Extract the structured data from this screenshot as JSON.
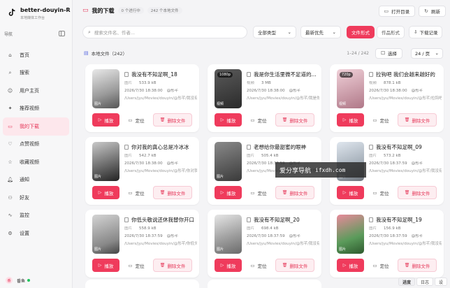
{
  "app": {
    "title": "better-douyin-R",
    "subtitle": "本地媒体工作台"
  },
  "sidebar": {
    "nav_heading": "导航",
    "items": [
      {
        "label": "首页",
        "icon": "home-icon"
      },
      {
        "label": "搜索",
        "icon": "search-icon"
      },
      {
        "label": "用户主页",
        "icon": "user-icon"
      },
      {
        "label": "推荐视频",
        "icon": "sparkle-icon"
      },
      {
        "label": "我的下载",
        "icon": "folder-icon",
        "active": true
      },
      {
        "label": "点赞视频",
        "icon": "heart-icon"
      },
      {
        "label": "收藏视频",
        "icon": "star-icon"
      },
      {
        "label": "通知",
        "icon": "bell-icon"
      },
      {
        "label": "好友",
        "icon": "friends-icon"
      },
      {
        "label": "监控",
        "icon": "pulse-icon"
      },
      {
        "label": "设置",
        "icon": "gear-icon"
      }
    ],
    "user": {
      "name": "番鱼",
      "avatar_text": "番"
    }
  },
  "header": {
    "title": "我的下载",
    "running_tasks": "0 个进行中",
    "local_files": "242 个本地文件",
    "open_folder": "打开目录",
    "refresh": "刷新"
  },
  "toolbar": {
    "search_placeholder": "搜索文件名、作者...",
    "type_filter": "全部类型",
    "sort": "最新优先",
    "view_files": "文件形式",
    "view_works": "作品形式",
    "download_records": "下载记录"
  },
  "list": {
    "label": "本地文件（242）",
    "range": "1–24 / 242",
    "select": "选择",
    "per_page": "24 / 页"
  },
  "card_labels": {
    "play": "播放",
    "locate": "定位",
    "delete": "删除文件",
    "image_tag": "图片",
    "video_tag": "视频"
  },
  "cards": [
    {
      "title": "我没有不知足啊_18",
      "kind": "图片",
      "size": "533.9 kB",
      "date": "2026/7/30 18:38:00",
      "author": "@彤芊",
      "path": "/Users/jyu/Movies/douyin/@彤芊/我没有...",
      "thumb_tag": "图片",
      "badge": ""
    },
    {
      "title": "我是你生活里微不足道的...",
      "kind": "视频",
      "size": "3 MB",
      "date": "2026/7/30 18:38:00",
      "author": "@彤芊",
      "path": "/Users/jyu/Movies/douyin/@彤芊/我是你...",
      "thumb_tag": "视频",
      "badge": "1080p"
    },
    {
      "title": "拉钩吧 我们会越来越好的",
      "kind": "视频",
      "size": "878.1 kB",
      "date": "2026/7/30 18:38:00",
      "author": "@彤芊",
      "path": "/Users/jyu/Movies/douyin/@彤芊/拉钩吧...",
      "thumb_tag": "视频",
      "badge": "720p"
    },
    {
      "title": "你对我的真心总是冷冰冰",
      "kind": "图片",
      "size": "542.7 kB",
      "date": "2026/7/30 18:38:00",
      "author": "@彤芊",
      "path": "/Users/jyu/Movies/douyin/@彤芊/你对我...",
      "thumb_tag": "图片",
      "badge": ""
    },
    {
      "title": "老想给你最甜蜜的眼神",
      "kind": "图片",
      "size": "505.4 kB",
      "date": "2026/7/30 18:37:59",
      "author": "@彤芊",
      "path": "/Users/jyu/Movies/douyin/@彤芊/老想给...",
      "thumb_tag": "图片",
      "badge": ""
    },
    {
      "title": "我没有不知足啊_09",
      "kind": "图片",
      "size": "573.2 kB",
      "date": "2026/7/30 18:37:59",
      "author": "@彤芊",
      "path": "/Users/jyu/Movies/douyin/@彤芊/我没有...",
      "thumb_tag": "图片",
      "badge": ""
    },
    {
      "title": "你低头敬说还休我替你开口",
      "kind": "图片",
      "size": "558.9 kB",
      "date": "2026/7/30 18:37:59",
      "author": "@彤芊",
      "path": "/Users/jyu/Movies/douyin/@彤芊/你低头...",
      "thumb_tag": "图片",
      "badge": ""
    },
    {
      "title": "我没有不知足啊_20",
      "kind": "图片",
      "size": "698.4 kB",
      "date": "2026/7/30 18:37:59",
      "author": "@彤芊",
      "path": "/Users/jyu/Movies/douyin/@彤芊/我没有...",
      "thumb_tag": "图片",
      "badge": ""
    },
    {
      "title": "我没有不知足啊_19",
      "kind": "图片",
      "size": "156.9 kB",
      "date": "2026/7/30 18:37:59",
      "author": "@彤芊",
      "path": "/Users/jyu/Movies/douyin/@彤芊/我没有...",
      "thumb_tag": "图片",
      "badge": ""
    }
  ],
  "bottom_tabs": {
    "progress": "进度",
    "log": "日志",
    "other": "设"
  },
  "watermark": {
    "text": "爱分享导航",
    "domain": "ifxdh.com"
  },
  "colors": {
    "accent": "#ef3b5c",
    "sidebar_bg": "#f7f7f8",
    "page_bg": "#f4f4f6"
  }
}
